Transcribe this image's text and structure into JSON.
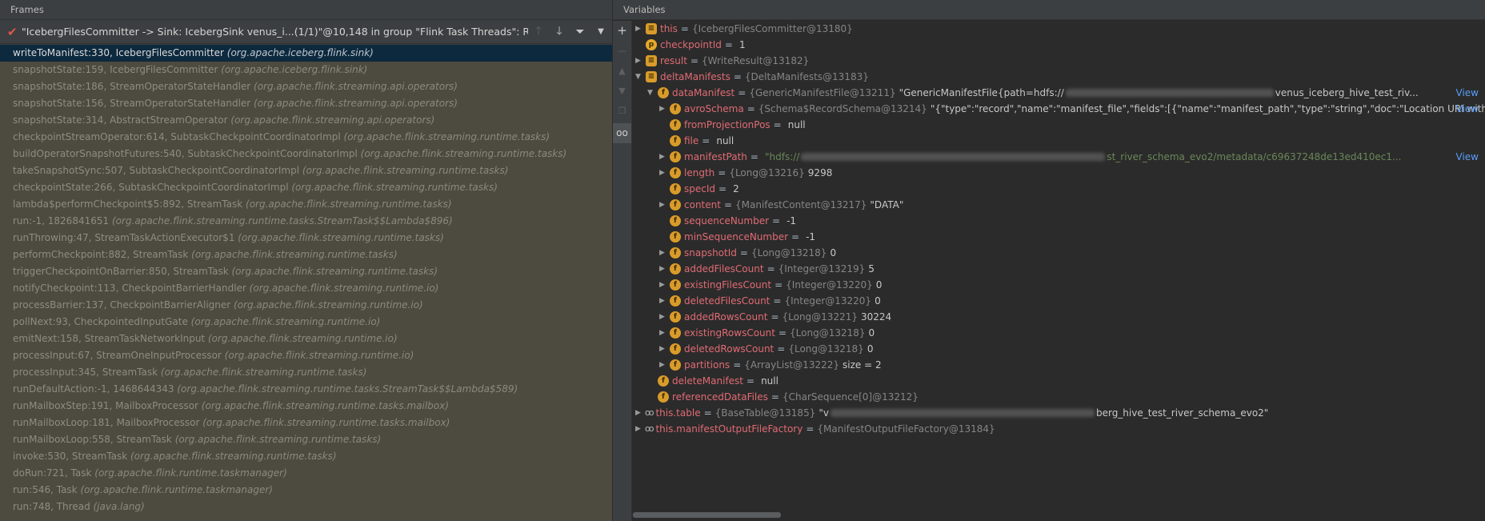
{
  "frames_panel": {
    "title": "Frames",
    "thread": "\"IcebergFilesCommitter -> Sink: IcebergSink venus_i...(1/1)\"@10,148 in group \"Flink Task Threads\": RUNNI...",
    "frames": [
      {
        "method": "writeToManifest:330, IcebergFilesCommitter",
        "pkg": "(org.apache.iceberg.flink.sink)"
      },
      {
        "method": "snapshotState:159, IcebergFilesCommitter",
        "pkg": "(org.apache.iceberg.flink.sink)"
      },
      {
        "method": "snapshotState:186, StreamOperatorStateHandler",
        "pkg": "(org.apache.flink.streaming.api.operators)"
      },
      {
        "method": "snapshotState:156, StreamOperatorStateHandler",
        "pkg": "(org.apache.flink.streaming.api.operators)"
      },
      {
        "method": "snapshotState:314, AbstractStreamOperator",
        "pkg": "(org.apache.flink.streaming.api.operators)"
      },
      {
        "method": "checkpointStreamOperator:614, SubtaskCheckpointCoordinatorImpl",
        "pkg": "(org.apache.flink.streaming.runtime.tasks)"
      },
      {
        "method": "buildOperatorSnapshotFutures:540, SubtaskCheckpointCoordinatorImpl",
        "pkg": "(org.apache.flink.streaming.runtime.tasks)"
      },
      {
        "method": "takeSnapshotSync:507, SubtaskCheckpointCoordinatorImpl",
        "pkg": "(org.apache.flink.streaming.runtime.tasks)"
      },
      {
        "method": "checkpointState:266, SubtaskCheckpointCoordinatorImpl",
        "pkg": "(org.apache.flink.streaming.runtime.tasks)"
      },
      {
        "method": "lambda$performCheckpoint$5:892, StreamTask",
        "pkg": "(org.apache.flink.streaming.runtime.tasks)"
      },
      {
        "method": "run:-1, 1826841651",
        "pkg": "(org.apache.flink.streaming.runtime.tasks.StreamTask$$Lambda$896)"
      },
      {
        "method": "runThrowing:47, StreamTaskActionExecutor$1",
        "pkg": "(org.apache.flink.streaming.runtime.tasks)"
      },
      {
        "method": "performCheckpoint:882, StreamTask",
        "pkg": "(org.apache.flink.streaming.runtime.tasks)"
      },
      {
        "method": "triggerCheckpointOnBarrier:850, StreamTask",
        "pkg": "(org.apache.flink.streaming.runtime.tasks)"
      },
      {
        "method": "notifyCheckpoint:113, CheckpointBarrierHandler",
        "pkg": "(org.apache.flink.streaming.runtime.io)"
      },
      {
        "method": "processBarrier:137, CheckpointBarrierAligner",
        "pkg": "(org.apache.flink.streaming.runtime.io)"
      },
      {
        "method": "pollNext:93, CheckpointedInputGate",
        "pkg": "(org.apache.flink.streaming.runtime.io)"
      },
      {
        "method": "emitNext:158, StreamTaskNetworkInput",
        "pkg": "(org.apache.flink.streaming.runtime.io)"
      },
      {
        "method": "processInput:67, StreamOneInputProcessor",
        "pkg": "(org.apache.flink.streaming.runtime.io)"
      },
      {
        "method": "processInput:345, StreamTask",
        "pkg": "(org.apache.flink.streaming.runtime.tasks)"
      },
      {
        "method": "runDefaultAction:-1, 1468644343",
        "pkg": "(org.apache.flink.streaming.runtime.tasks.StreamTask$$Lambda$589)"
      },
      {
        "method": "runMailboxStep:191, MailboxProcessor",
        "pkg": "(org.apache.flink.streaming.runtime.tasks.mailbox)"
      },
      {
        "method": "runMailboxLoop:181, MailboxProcessor",
        "pkg": "(org.apache.flink.streaming.runtime.tasks.mailbox)"
      },
      {
        "method": "runMailboxLoop:558, StreamTask",
        "pkg": "(org.apache.flink.streaming.runtime.tasks)"
      },
      {
        "method": "invoke:530, StreamTask",
        "pkg": "(org.apache.flink.streaming.runtime.tasks)"
      },
      {
        "method": "doRun:721, Task",
        "pkg": "(org.apache.flink.runtime.taskmanager)"
      },
      {
        "method": "run:546, Task",
        "pkg": "(org.apache.flink.runtime.taskmanager)"
      },
      {
        "method": "run:748, Thread",
        "pkg": "(java.lang)"
      }
    ]
  },
  "variables_panel": {
    "title": "Variables",
    "view_label": "View",
    "rows": [
      {
        "depth": 0,
        "exp": "▶",
        "icon": "lines",
        "name": "this",
        "type": "{IcebergFilesCommitter@13180}",
        "val": ""
      },
      {
        "depth": 0,
        "exp": "",
        "icon": "p",
        "name": "checkpointId",
        "type": "",
        "val": "1"
      },
      {
        "depth": 0,
        "exp": "▶",
        "icon": "lines",
        "name": "result",
        "type": "{WriteResult@13182}",
        "val": ""
      },
      {
        "depth": 0,
        "exp": "▼",
        "icon": "lines",
        "name": "deltaManifests",
        "type": "{DeltaManifests@13183}",
        "val": ""
      },
      {
        "depth": 1,
        "exp": "▼",
        "icon": "f",
        "name": "dataManifest",
        "type": "{GenericManifestFile@13211}",
        "str1": "\"GenericManifestFile{path=hdfs://",
        "str2": "venus_iceberg_hive_test_riv...",
        "view": true
      },
      {
        "depth": 2,
        "exp": "▶",
        "icon": "f",
        "name": "avroSchema",
        "type": "{Schema$RecordSchema@13214}",
        "str1": "\"{\"type\":\"record\",\"name\":\"manifest_file\",\"fields\":[{\"name\":\"manifest_path\",\"type\":\"string\",\"doc\":\"Location URI with f...",
        "view": true
      },
      {
        "depth": 2,
        "exp": "",
        "icon": "f",
        "name": "fromProjectionPos",
        "type": "",
        "val": "null"
      },
      {
        "depth": 2,
        "exp": "",
        "icon": "f",
        "name": "file",
        "type": "",
        "val": "null"
      },
      {
        "depth": 2,
        "exp": "▶",
        "icon": "f",
        "name": "manifestPath",
        "type": "",
        "str1": "\"hdfs://",
        "str2": "st_river_schema_evo2/metadata/c69637248de13ed410ec1...",
        "view": true
      },
      {
        "depth": 2,
        "exp": "▶",
        "icon": "f",
        "name": "length",
        "type": "{Long@13216}",
        "val": "9298"
      },
      {
        "depth": 2,
        "exp": "",
        "icon": "f",
        "name": "specId",
        "type": "",
        "val": "2"
      },
      {
        "depth": 2,
        "exp": "▶",
        "icon": "f",
        "name": "content",
        "type": "{ManifestContent@13217}",
        "val": "\"DATA\""
      },
      {
        "depth": 2,
        "exp": "",
        "icon": "f",
        "name": "sequenceNumber",
        "type": "",
        "val": "-1"
      },
      {
        "depth": 2,
        "exp": "",
        "icon": "f",
        "name": "minSequenceNumber",
        "type": "",
        "val": "-1"
      },
      {
        "depth": 2,
        "exp": "▶",
        "icon": "f",
        "name": "snapshotId",
        "type": "{Long@13218}",
        "val": "0"
      },
      {
        "depth": 2,
        "exp": "▶",
        "icon": "f",
        "name": "addedFilesCount",
        "type": "{Integer@13219}",
        "val": "5"
      },
      {
        "depth": 2,
        "exp": "▶",
        "icon": "f",
        "name": "existingFilesCount",
        "type": "{Integer@13220}",
        "val": "0"
      },
      {
        "depth": 2,
        "exp": "▶",
        "icon": "f",
        "name": "deletedFilesCount",
        "type": "{Integer@13220}",
        "val": "0"
      },
      {
        "depth": 2,
        "exp": "▶",
        "icon": "f",
        "name": "addedRowsCount",
        "type": "{Long@13221}",
        "val": "30224"
      },
      {
        "depth": 2,
        "exp": "▶",
        "icon": "f",
        "name": "existingRowsCount",
        "type": "{Long@13218}",
        "val": "0"
      },
      {
        "depth": 2,
        "exp": "▶",
        "icon": "f",
        "name": "deletedRowsCount",
        "type": "{Long@13218}",
        "val": "0"
      },
      {
        "depth": 2,
        "exp": "▶",
        "icon": "f",
        "name": "partitions",
        "type": "{ArrayList@13222}",
        "val": " size = 2"
      },
      {
        "depth": 1,
        "exp": "",
        "icon": "f",
        "name": "deleteManifest",
        "type": "",
        "val": "null"
      },
      {
        "depth": 1,
        "exp": "",
        "icon": "f",
        "name": "referencedDataFiles",
        "type": "{CharSequence[0]@13212}",
        "val": ""
      },
      {
        "depth": 0,
        "exp": "▶",
        "icon": "oo",
        "name": "this.table",
        "type": "{BaseTable@13185}",
        "str1": "\"v",
        "str2": "berg_hive_test_river_schema_evo2\""
      },
      {
        "depth": 0,
        "exp": "▶",
        "icon": "oo",
        "name": "this.manifestOutputFileFactory",
        "type": "{ManifestOutputFileFactory@13184}",
        "val": ""
      }
    ]
  },
  "colors": {
    "frames_bg": "#4d4a3f",
    "selected_bg": "#0d293e",
    "var_name": "#e06b74",
    "string_value": "#6a8759",
    "link": "#589df6"
  }
}
